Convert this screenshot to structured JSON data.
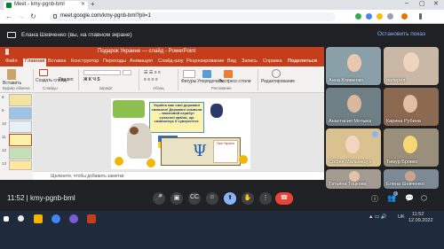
{
  "browser": {
    "tab_title": "Meet - kmy-pgnb-bml",
    "url": "meet.google.com/kmy-pgnb-bml?pli=1"
  },
  "banner": {
    "presenter_text": "Елана Шевченко (вы, на главном экране)",
    "stop_label": "Остановить показ"
  },
  "powerpoint": {
    "title": "Подарок Украине — слайд - PowerPoint",
    "tabs": [
      "Файл",
      "Главная",
      "Вставка",
      "Конструктор",
      "Переходы",
      "Анимация",
      "Слайд-шоу",
      "Рецензирование",
      "Вид",
      "Запись",
      "Справка",
      "Поделиться"
    ],
    "ribbon_labels": {
      "paste": "Вставить",
      "new_slide": "Создать слайд",
      "sections": "Раздел",
      "font": "Шрифт",
      "paragraph": "Абзац",
      "drawing": "Рисование",
      "arrange": "Упорядочить",
      "shapes": "Фигуры",
      "quick_styles": "Экспресс-стили",
      "editing": "Редактирование",
      "clipboard": "Буфер обмена",
      "slides": "Слайды"
    },
    "slide_numbers": [
      "8",
      "9",
      "10",
      "11",
      "12",
      "13"
    ],
    "slide_question": "Україна має свої державні символи! Державні символи – важливий атрибут сучасної країни, що символізує її суверенітет.",
    "slide_page_title": "Гімн України",
    "notes_placeholder": "Щелкните, чтобы добавить заметки"
  },
  "participants": [
    {
      "name": "Анна Клименко",
      "bg": "#8aa0a8"
    },
    {
      "name": "валерия",
      "bg": "#c9b8a5"
    },
    {
      "name": "Анастасия Мотыка",
      "bg": "#6f7f86"
    },
    {
      "name": "Карина Рубина",
      "bg": "#8c6a52"
    },
    {
      "name": "София Мальмедук",
      "bg": "#d9c28f"
    },
    {
      "name": "Тимур Бровко",
      "bg": "#9a8f7a"
    },
    {
      "name": "Татьяна Тоцкова",
      "bg": "#a39a90"
    },
    {
      "name": "Елена Шевченко",
      "bg": "#7d8a95"
    }
  ],
  "meeting": {
    "time_code": "11:52 | kmy-pgnb-bml",
    "participant_count": "9"
  },
  "taskbar": {
    "lang": "UK",
    "clock_time": "11:52",
    "clock_date": "12.09.2022"
  },
  "colors": {
    "powerpoint_accent": "#c43e1c",
    "meet_bg": "#202124",
    "meet_blue": "#8ab4f8",
    "end_call": "#ea4335"
  }
}
